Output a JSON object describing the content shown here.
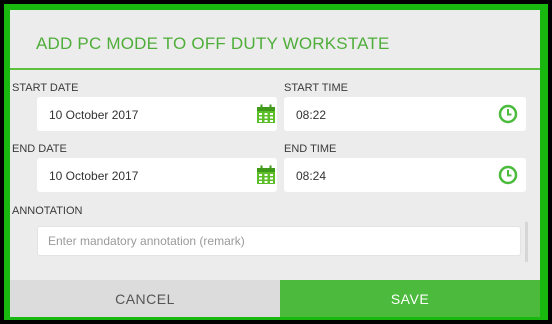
{
  "dialog": {
    "title": "ADD PC MODE TO OFF DUTY WORKSTATE"
  },
  "start_date": {
    "label": "START DATE",
    "value": "10 October 2017",
    "icon": "calendar-icon"
  },
  "start_time": {
    "label": "START TIME",
    "value": "08:22",
    "icon": "clock-icon"
  },
  "end_date": {
    "label": "END DATE",
    "value": "10 October 2017",
    "icon": "calendar-icon"
  },
  "end_time": {
    "label": "END TIME",
    "value": "08:24",
    "icon": "clock-icon"
  },
  "annotation": {
    "label": "ANNOTATION",
    "value": "",
    "placeholder": "Enter mandatory annotation (remark)"
  },
  "buttons": {
    "cancel": "CANCEL",
    "save": "SAVE"
  },
  "colors": {
    "accent": "#4cba3c",
    "frame": "#18b80f",
    "background": "#ececec"
  }
}
